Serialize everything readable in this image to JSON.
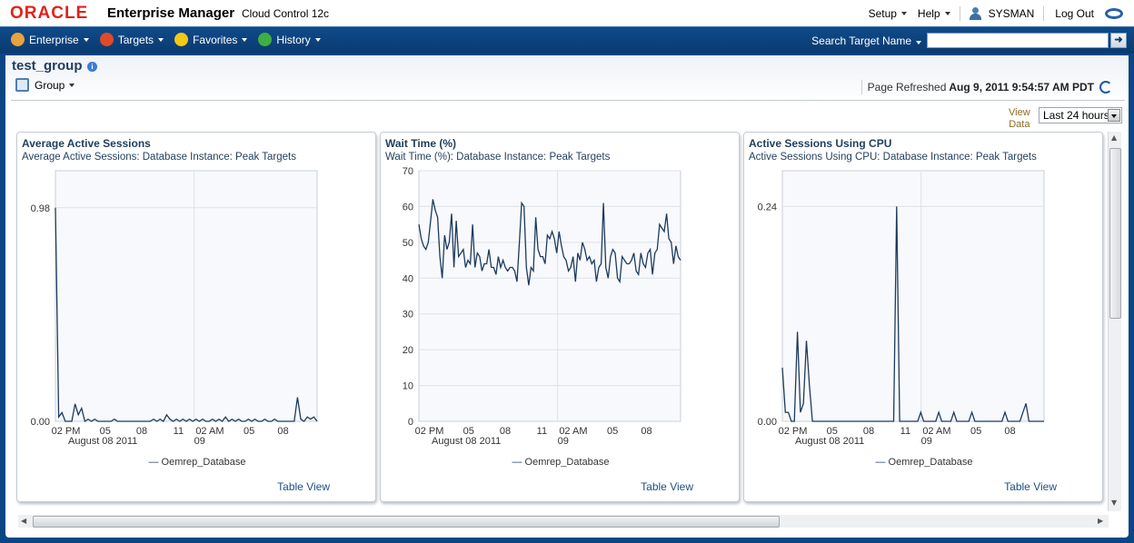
{
  "app": {
    "brand": "ORACLE",
    "product": "Enterprise Manager",
    "edition": "Cloud Control 12c"
  },
  "toplinks": {
    "setup": "Setup",
    "help": "Help",
    "user": "SYSMAN",
    "logout": "Log Out"
  },
  "nav": {
    "items": [
      {
        "label": "Enterprise",
        "icon": "cube-icon",
        "color": "#e8a33c"
      },
      {
        "label": "Targets",
        "icon": "target-icon",
        "color": "#e04a2a"
      },
      {
        "label": "Favorites",
        "icon": "star-icon",
        "color": "#f4c917"
      },
      {
        "label": "History",
        "icon": "clock-icon",
        "color": "#3cb043"
      }
    ],
    "search_label": "Search Target Name",
    "search_value": ""
  },
  "page": {
    "title": "test_group",
    "menu": "Group",
    "refreshed_label": "Page Refreshed",
    "refreshed_value": "Aug 9, 2011 9:54:57 AM PDT",
    "view_data_label_1": "View",
    "view_data_label_2": "Data",
    "view_data_value": "Last 24 hours"
  },
  "chart_data": [
    {
      "type": "line",
      "title": "Average Active Sessions",
      "subtitle": "Average Active Sessions: Database Instance: Peak Targets",
      "yticks": [
        "0.00",
        "0.98"
      ],
      "ylim": [
        0,
        1.15
      ],
      "ytick_values": [
        0,
        0.98
      ],
      "xticks": [
        "02 PM",
        "05",
        "08",
        "11",
        "02 AM",
        "05",
        "08"
      ],
      "xsub": [
        "August 08 2011",
        "09"
      ],
      "legend": "Oemrep_Database",
      "link": "Table View",
      "series": [
        {
          "name": "Oemrep_Database",
          "values": [
            0.98,
            0.02,
            0.04,
            0.0,
            0.0,
            0.0,
            0.08,
            0.03,
            0.06,
            0.0,
            0.01,
            0.0,
            0.01,
            0.0,
            0.0,
            0.0,
            0.0,
            0.0,
            0.01,
            0.0,
            0.0,
            0.0,
            0.0,
            0.0,
            0.0,
            0.0,
            0.0,
            0.0,
            0.0,
            0.0,
            0.01,
            0.0,
            0.01,
            0.0,
            0.03,
            0.01,
            0.0,
            0.01,
            0.0,
            0.01,
            0.0,
            0.01,
            0.0,
            0.01,
            0.0,
            0.01,
            0.0,
            0.0,
            0.01,
            0.0,
            0.01,
            0.0,
            0.02,
            0.0,
            0.01,
            0.0,
            0.01,
            0.0,
            0.0,
            0.01,
            0.0,
            0.01,
            0.0,
            0.0,
            0.01,
            0.0,
            0.0,
            0.01,
            0.0,
            0.0,
            0.0,
            0.0,
            0.0,
            0.0,
            0.11,
            0.01,
            0.0,
            0.02,
            0.01,
            0.02,
            0.0
          ]
        }
      ]
    },
    {
      "type": "line",
      "title": "Wait Time (%)",
      "subtitle": "Wait Time (%): Database Instance: Peak Targets",
      "yticks": [
        "0",
        "10",
        "20",
        "30",
        "40",
        "50",
        "60",
        "70"
      ],
      "ylim": [
        0,
        70
      ],
      "ytick_values": [
        0,
        10,
        20,
        30,
        40,
        50,
        60,
        70
      ],
      "xticks": [
        "02 PM",
        "05",
        "08",
        "11",
        "02 AM",
        "05",
        "08"
      ],
      "xsub": [
        "August 08 2011",
        "09"
      ],
      "legend": "Oemrep_Database",
      "link": "Table View",
      "series": [
        {
          "name": "Oemrep_Database",
          "values": [
            55,
            51,
            49,
            48,
            50,
            56,
            62,
            59,
            57,
            46,
            40,
            52,
            48,
            50,
            58,
            43,
            56,
            46,
            47,
            48,
            43,
            45,
            44,
            55,
            43,
            47,
            46,
            42,
            44,
            44,
            48,
            43,
            43,
            41,
            46,
            43,
            45,
            43,
            42,
            43,
            43,
            42,
            39,
            50,
            61,
            60,
            43,
            38,
            43,
            42,
            57,
            48,
            46,
            46,
            44,
            52,
            51,
            53,
            51,
            47,
            53,
            49,
            46,
            45,
            42,
            43,
            46,
            39,
            47,
            45,
            50,
            48,
            45,
            46,
            44,
            45,
            39,
            43,
            44,
            61,
            43,
            40,
            46,
            48,
            47,
            40,
            39,
            46,
            45,
            44,
            44,
            45,
            47,
            42,
            41,
            47,
            44,
            43,
            47,
            48,
            41,
            47,
            48,
            55,
            54,
            53,
            58,
            51,
            50,
            44,
            49,
            46,
            45
          ]
        }
      ]
    },
    {
      "type": "line",
      "title": "Active Sessions Using CPU",
      "subtitle": "Active Sessions Using CPU: Database Instance: Peak Targets",
      "yticks": [
        "0.00",
        "0.24"
      ],
      "ylim": [
        0,
        0.28
      ],
      "ytick_values": [
        0,
        0.24
      ],
      "xticks": [
        "02 PM",
        "05",
        "08",
        "11",
        "02 AM",
        "05",
        "08"
      ],
      "xsub": [
        "August 08 2011",
        "09"
      ],
      "legend": "Oemrep_Database",
      "link": "Table View",
      "series": [
        {
          "name": "Oemrep_Database",
          "values": [
            0.06,
            0.01,
            0.01,
            0.0,
            0.0,
            0.1,
            0.01,
            0.02,
            0.09,
            0.04,
            0.0,
            0.0,
            0.0,
            0.0,
            0.0,
            0.0,
            0.0,
            0.0,
            0.0,
            0.0,
            0.0,
            0.0,
            0.0,
            0.0,
            0.0,
            0.0,
            0.0,
            0.0,
            0.0,
            0.0,
            0.0,
            0.0,
            0.0,
            0.0,
            0.0,
            0.0,
            0.0,
            0.0,
            0.24,
            0.0,
            0.0,
            0.0,
            0.0,
            0.0,
            0.0,
            0.0,
            0.01,
            0.0,
            0.0,
            0.0,
            0.0,
            0.0,
            0.01,
            0.0,
            0.0,
            0.0,
            0.0,
            0.01,
            0.0,
            0.0,
            0.0,
            0.0,
            0.0,
            0.01,
            0.0,
            0.0,
            0.0,
            0.0,
            0.0,
            0.0,
            0.0,
            0.0,
            0.0,
            0.0,
            0.01,
            0.0,
            0.0,
            0.0,
            0.0,
            0.0,
            0.01,
            0.02,
            0.0,
            0.0,
            0.0,
            0.0,
            0.0,
            0.0
          ]
        }
      ]
    }
  ]
}
